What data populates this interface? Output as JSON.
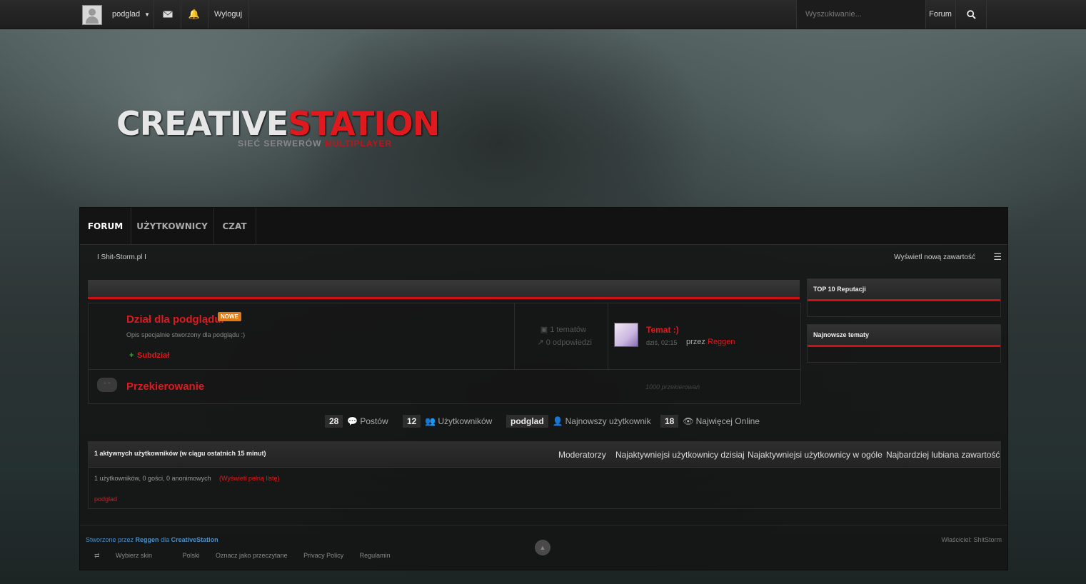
{
  "topbar": {
    "username": "podglad",
    "dropdown_icon": "caret-down-icon",
    "messages_icon": "envelope-icon",
    "notifications_icon": "bell-icon",
    "logout_label": "Wyloguj",
    "search_placeholder": "Wyszukiwanie...",
    "search_scope": "Forum",
    "search_icon": "search-icon"
  },
  "logo": {
    "part1": "CREATIVE",
    "part2": "STATION",
    "sub1": "SIEĆ SERWERÓW",
    "sub2": "MULTIPLAYER"
  },
  "nav": {
    "tabs": [
      {
        "label": "FORUM",
        "active": true
      },
      {
        "label": "UŻYTKOWNICY",
        "active": false
      },
      {
        "label": "CZAT",
        "active": false
      }
    ]
  },
  "breadcrumb": {
    "text": "I Shit-Storm.pl I",
    "new_content": "Wyświetl nową zawartość"
  },
  "forum": {
    "title": "Dział dla podglądu.",
    "badge": "NOWE",
    "description": "Opis specjalnie stworzony dla podglądu :)",
    "subforum_plus": "+",
    "subforum": "Subdział",
    "topics": "1 tematów",
    "replies": "0 odpowiedzi",
    "last_title": "Temat :)",
    "last_time": "dziś, 02:15",
    "last_by": "przez",
    "last_user": "Reggen",
    "redirect_title": "Przekierowanie",
    "redirect_count": "1000 przekierowań"
  },
  "sidebar": {
    "top_rep": "TOP 10 Reputacji",
    "newest_topics": "Najnowsze tematy"
  },
  "stats": {
    "posts_num": "28",
    "posts_label": "Postów",
    "users_num": "12",
    "users_label": "Użytkowników",
    "newest_user": "podglad",
    "newest_label": "Najnowszy użytkownik",
    "online_num": "18",
    "online_label": "Najwięcej Online"
  },
  "online": {
    "heading": "1 aktywnych użytkowników (w ciągu ostatnich 15 minut)",
    "tabs": [
      "Moderatorzy",
      "Najaktywniejsi użytkownicy dzisiaj",
      "Najaktywniejsi użytkownicy w ogóle",
      "Najbardziej lubiana zawartość"
    ],
    "summary": "1 użytkowników, 0 gości, 0 anonimowych",
    "full_list": "(Wyświetl pełną listę)",
    "user": "podglad"
  },
  "footer": {
    "created_by": "Stworzone przez",
    "author": "Reggen",
    "for": "dla",
    "site": "CreativeStation",
    "owner": "Właściciel: ShitStorm",
    "links": [
      "Wybierz skin",
      "Polski",
      "Oznacz jako przeczytane",
      "Privacy Policy",
      "Regulamin"
    ]
  },
  "colors": {
    "accent_red": "#e0191e",
    "badge_orange": "#e07a12"
  }
}
